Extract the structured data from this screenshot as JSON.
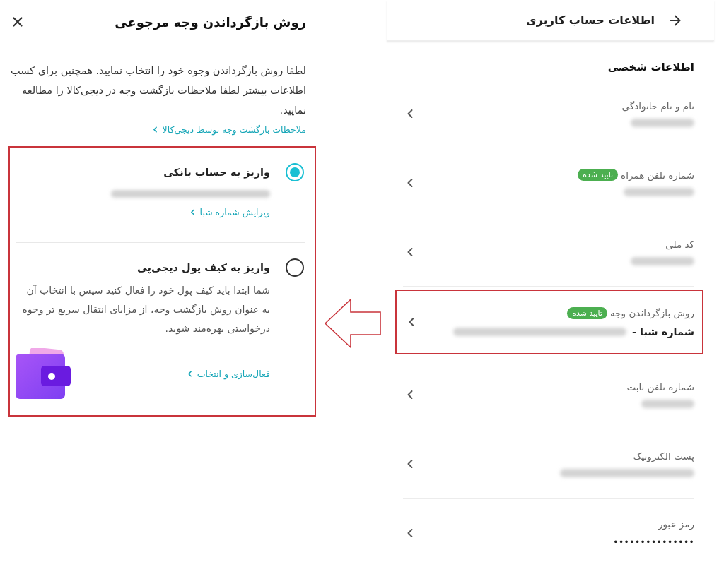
{
  "refund_panel": {
    "title": "روش بازگرداندن وجه مرجوعی",
    "intro": "لطفا روش بازگرداندن وجوه خود را انتخاب نمایید. همچنین برای کسب اطلاعات بیشتر لطفا ملاحظات بازگشت وجه در دیجی‌کالا را مطالعه نمایید.",
    "link": "ملاحظات بازگشت وجه توسط دیجی‌کالا",
    "highlighted": true,
    "options": [
      {
        "kind": "bank",
        "title": "واریز به حساب بانکی",
        "selected": true,
        "link": "ویرایش شماره شبا"
      },
      {
        "kind": "wallet",
        "title": "واریز به کیف پول دیجی‌پی",
        "selected": false,
        "description": "شما ابتدا باید کیف پول خود را فعال کنید سپس با انتخاب آن به عنوان روش بازگشت وجه، از مزایای انتقال سریع تر وجوه درخواستی بهره‌مند شوید.",
        "link": "فعال‌سازی و انتخاب"
      }
    ]
  },
  "account_panel": {
    "title": "اطلاعات حساب کاربری",
    "section_title": "اطلاعات شخصی",
    "fields": [
      {
        "label": "نام و نام خانوادگی",
        "kind": "blurred",
        "highlighted": false
      },
      {
        "label": "شماره تلفن همراه",
        "badge": "تایید شده",
        "kind": "blurred",
        "highlighted": false
      },
      {
        "label": "کد ملی",
        "kind": "blurred",
        "highlighted": false
      },
      {
        "label": "روش بازگرداندن وجه",
        "badge": "تایید شده",
        "kind": "shaba",
        "value": "شماره شبا -",
        "highlighted": true
      },
      {
        "label": "شماره تلفن ثابت",
        "kind": "blurred",
        "highlighted": false
      },
      {
        "label": "پست الکترونیک",
        "kind": "blurred",
        "highlighted": false
      },
      {
        "label": "رمز عبور",
        "kind": "password",
        "value": "•••••••••••••••",
        "highlighted": false
      }
    ]
  }
}
